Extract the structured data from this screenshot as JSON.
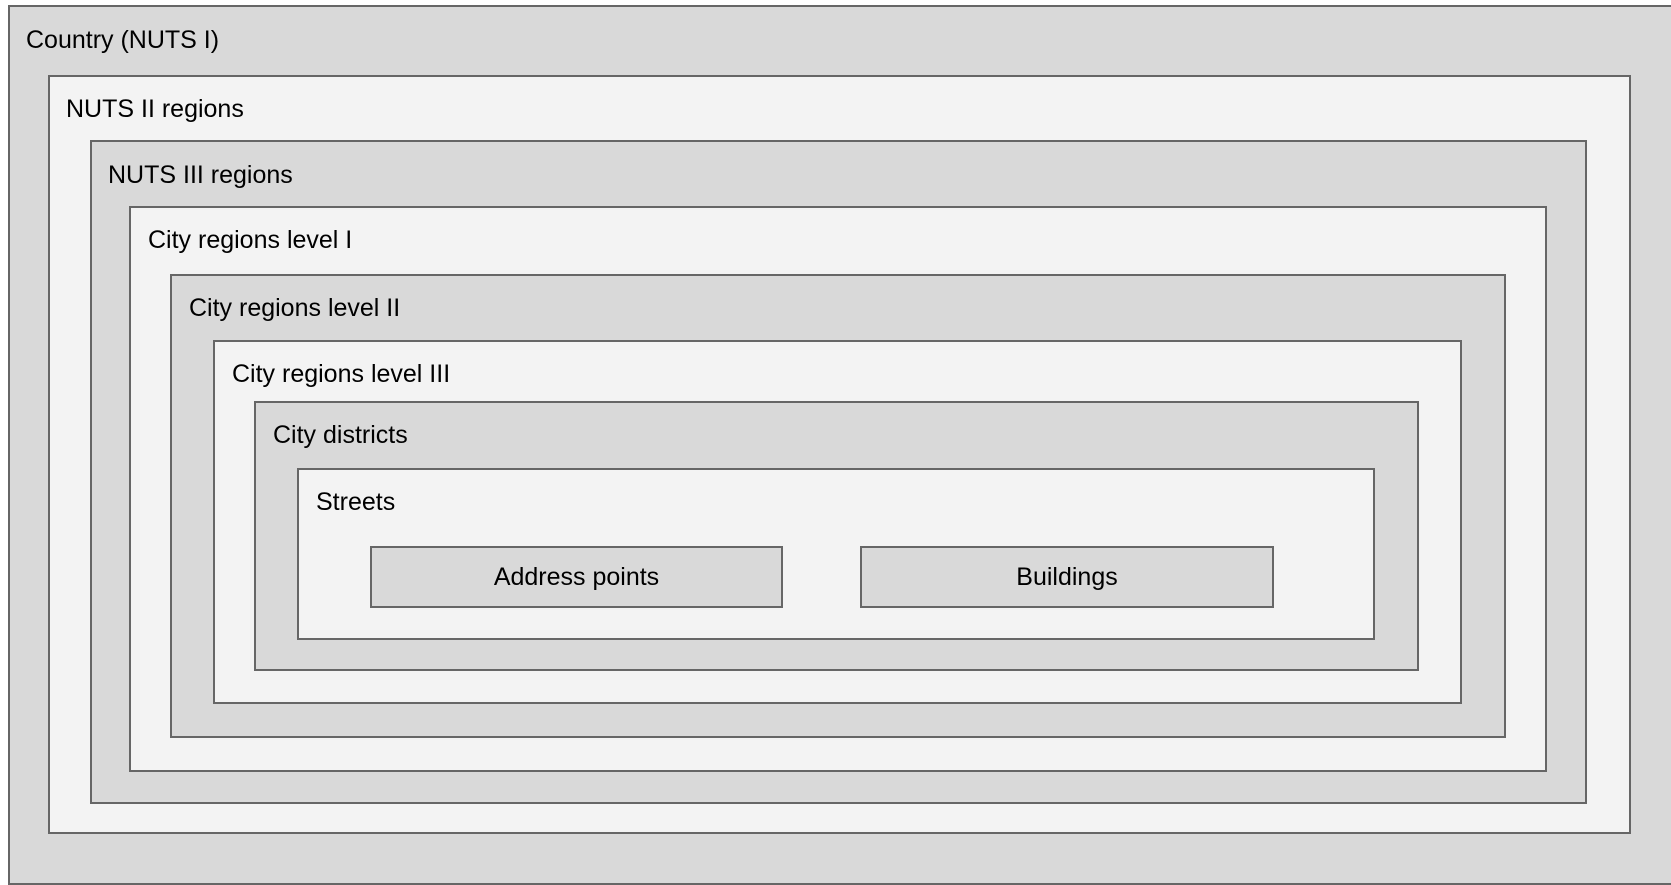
{
  "levels": [
    {
      "label": "Country (NUTS I)"
    },
    {
      "label": "NUTS II regions"
    },
    {
      "label": "NUTS III regions"
    },
    {
      "label": "City regions level I"
    },
    {
      "label": "City regions level II"
    },
    {
      "label": "City regions level III"
    },
    {
      "label": "City districts"
    },
    {
      "label": "Streets"
    }
  ],
  "leaves": [
    {
      "label": "Address points"
    },
    {
      "label": "Buildings"
    }
  ],
  "colors": {
    "dark_fill": "#d9d9d9",
    "light_fill": "#f3f3f3",
    "border": "#666666"
  }
}
